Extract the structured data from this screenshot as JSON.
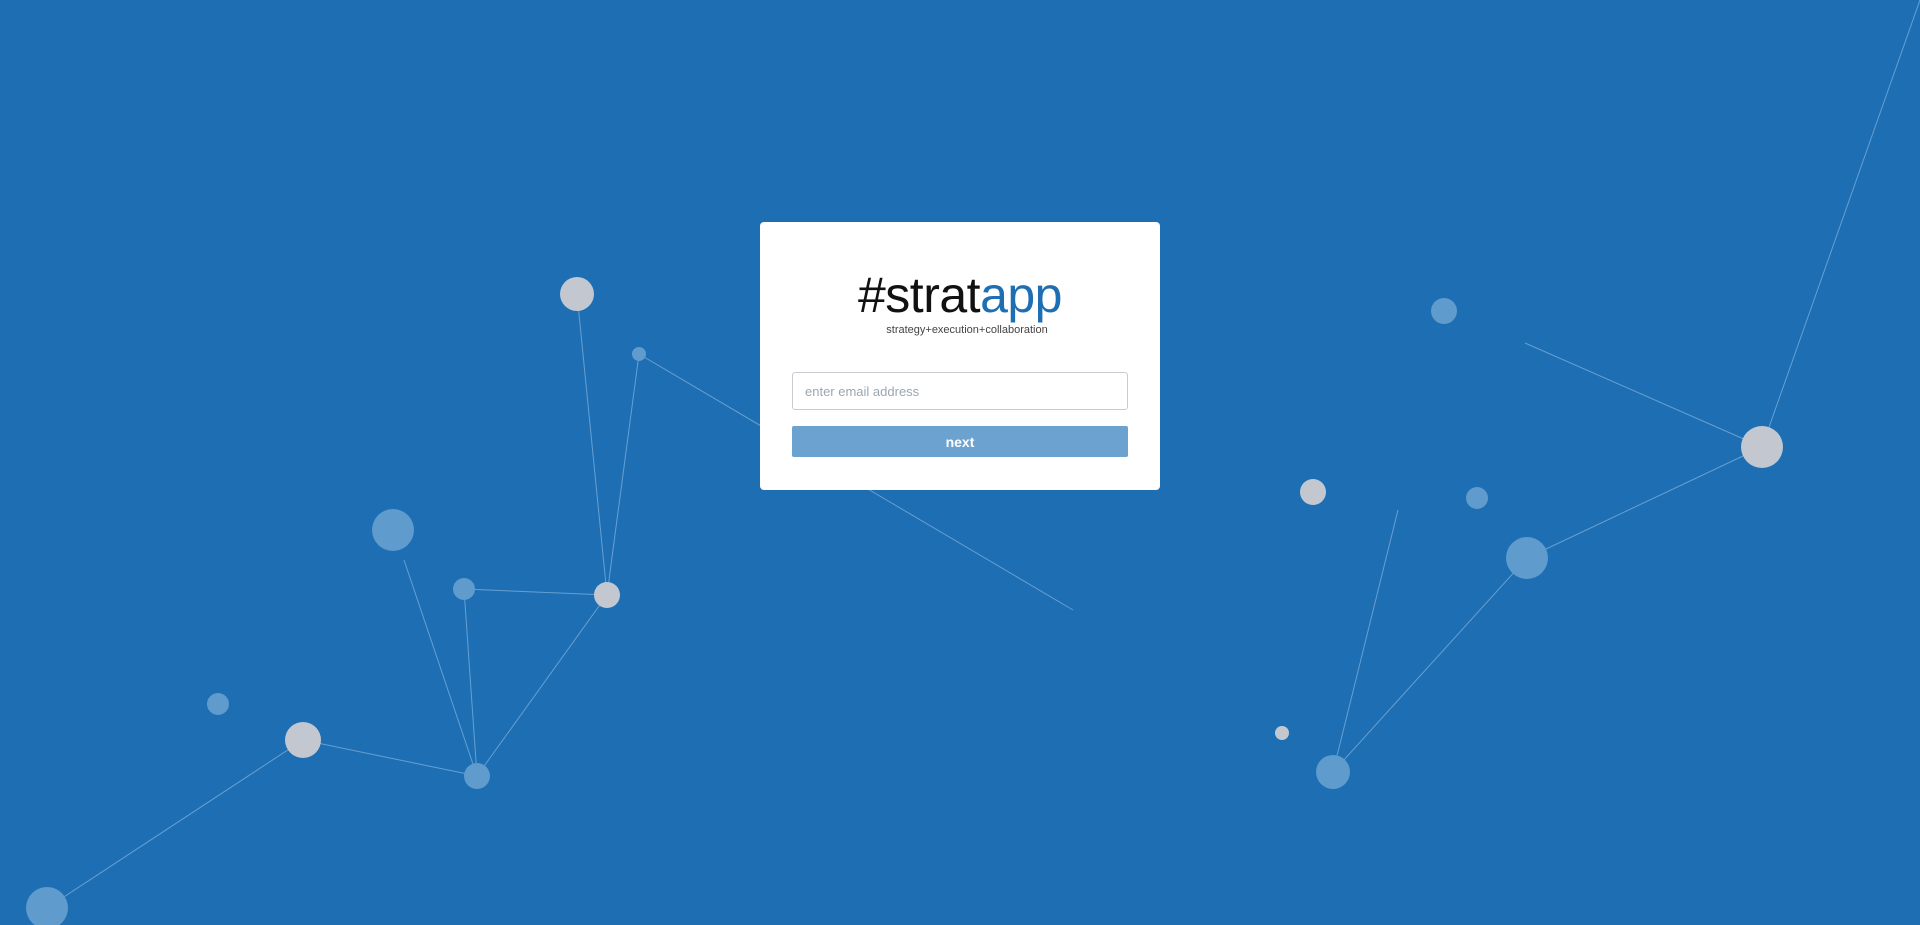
{
  "brand": {
    "logo_prefix": "#strat",
    "logo_suffix": "app",
    "tagline": "strategy+execution+collaboration"
  },
  "login": {
    "email_placeholder": "enter email address",
    "email_value": "",
    "next_label": "next"
  },
  "colors": {
    "background": "#1e6eb3",
    "accent": "#1e6eb3",
    "button": "#6ba2d0",
    "node_light": "#c3c8d0",
    "node_blue": "#5f9bcd",
    "line": "#7eb0dc"
  }
}
